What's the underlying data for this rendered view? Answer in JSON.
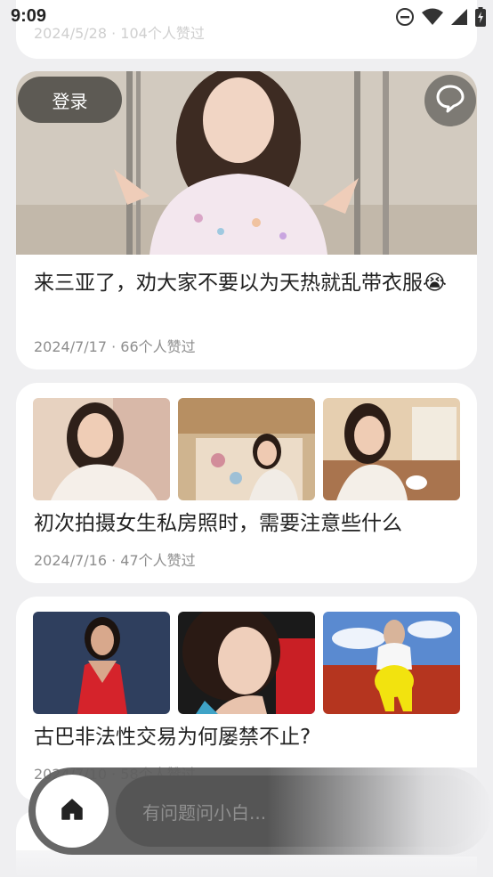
{
  "status": {
    "time": "9:09"
  },
  "feed": [
    {
      "meta": "2024/5/28 · 104个人赞过"
    },
    {
      "title": "来三亚了，劝大家不要以为天热就乱带衣服😭",
      "meta": "2024/7/17 · 66个人赞过"
    },
    {
      "title": "初次拍摄女生私房照时，需要注意些什么",
      "meta": "2024/7/16 · 47个人赞过"
    },
    {
      "title": "古巴非法性交易为何屡禁不止?",
      "meta": "2024/7/10 · 58个人赞过"
    }
  ],
  "overlay": {
    "login_label": "登录"
  },
  "bottom_bar": {
    "input_placeholder": "有问题问小白..."
  },
  "icons": {
    "status": [
      "dnd-icon",
      "wifi-icon",
      "signal-icon",
      "battery-icon"
    ],
    "chat": "chat-bubble-icon",
    "home": "home-icon"
  },
  "colors": {
    "background": "#efeff1",
    "card": "#ffffff",
    "meta_text": "#8e8e8e",
    "bottom_bar": "#5f5f5f",
    "login_button": "#504e48"
  }
}
